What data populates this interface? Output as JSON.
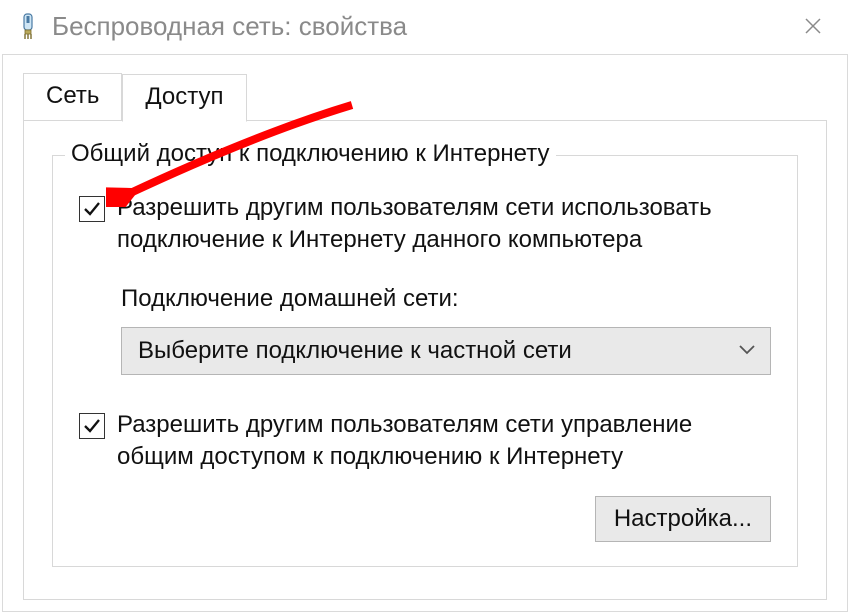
{
  "window": {
    "title": "Беспроводная сеть: свойства"
  },
  "tabs": {
    "network": "Сеть",
    "access": "Доступ"
  },
  "group": {
    "legend": "Общий доступ к подключению к Интернету"
  },
  "checkbox1": {
    "label": "Разрешить другим пользователям сети использовать подключение к Интернету данного компьютера",
    "checked": true
  },
  "homeConnection": {
    "label": "Подключение домашней сети:",
    "selected": "Выберите подключение к частной сети"
  },
  "checkbox2": {
    "label": "Разрешить другим пользователям сети управление общим доступом к подключению к Интернету",
    "checked": true
  },
  "buttons": {
    "settings": "Настройка..."
  },
  "annotation": {
    "color": "#ff0000"
  }
}
